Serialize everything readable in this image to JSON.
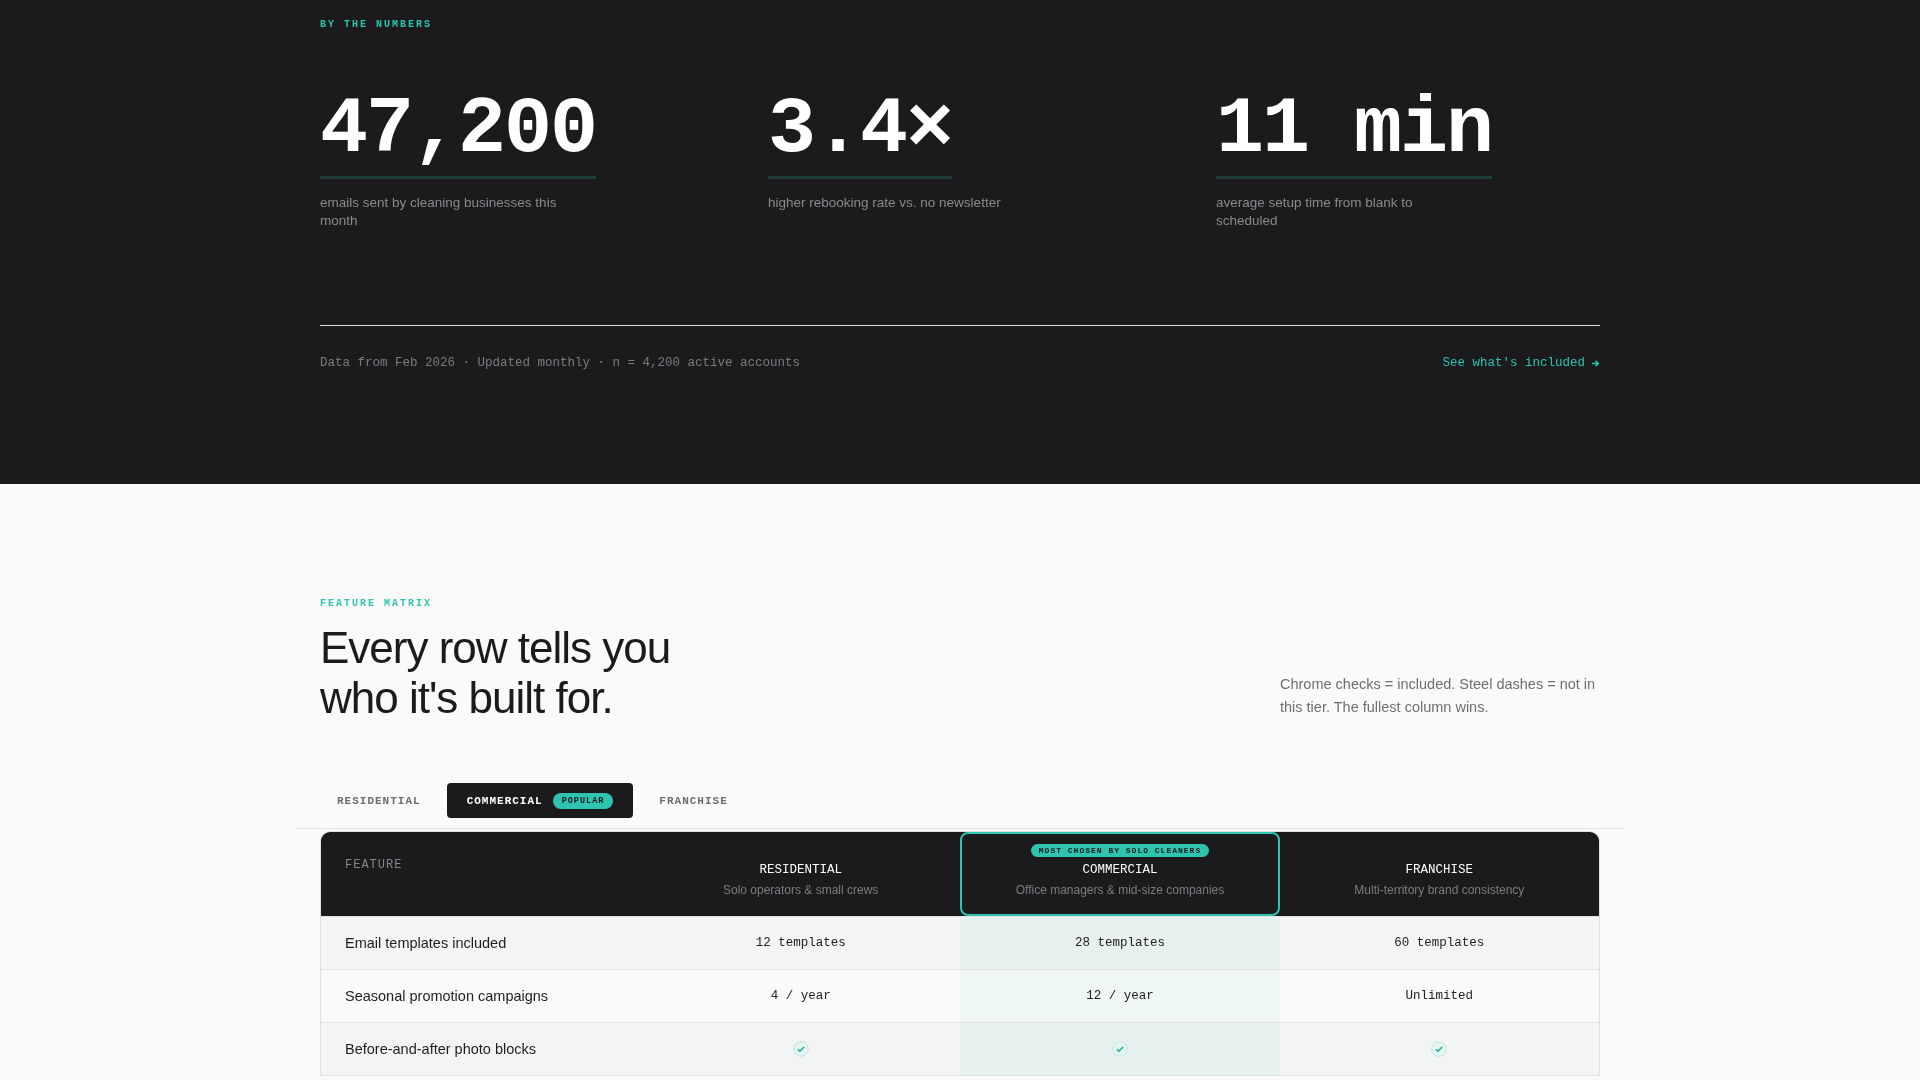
{
  "numbers": {
    "eyebrow": "BY THE NUMBERS",
    "stats": [
      {
        "value": "47,200",
        "caption": "emails sent by cleaning businesses this month"
      },
      {
        "value": "3.4×",
        "caption": "higher rebooking rate vs. no newsletter"
      },
      {
        "value": "11 min",
        "caption": "average setup time from blank to scheduled"
      }
    ],
    "footnote": "Data from Feb 2026 · Updated monthly · n = 4,200 active accounts",
    "link": "See what's included"
  },
  "matrix": {
    "eyebrow": "FEATURE MATRIX",
    "heading": "Every row tells you who it's built for.",
    "note": "Chrome checks = included. Steel dashes = not in this tier. The fullest column wins.",
    "tabs": [
      {
        "label": "RESIDENTIAL",
        "selected": false
      },
      {
        "label": "COMMERCIAL",
        "selected": true,
        "badge": "POPULAR"
      },
      {
        "label": "FRANCHISE",
        "selected": false
      }
    ],
    "feature_heading": "FEATURE",
    "columns": [
      {
        "name": "RESIDENTIAL",
        "subtitle": "Solo operators & small crews",
        "highlighted": false
      },
      {
        "name": "COMMERCIAL",
        "subtitle": "Office managers & mid-size companies",
        "highlighted": true,
        "badge": "MOST CHOSEN BY SOLO CLEANERS"
      },
      {
        "name": "FRANCHISE",
        "subtitle": "Multi-territory brand consistency",
        "highlighted": false
      }
    ],
    "rows": [
      {
        "feature": "Email templates included",
        "cells": [
          {
            "kind": "text",
            "text": "12 templates"
          },
          {
            "kind": "text",
            "text": "28 templates"
          },
          {
            "kind": "text",
            "text": "60 templates"
          }
        ]
      },
      {
        "feature": "Seasonal promotion campaigns",
        "cells": [
          {
            "kind": "text",
            "text": "4 / year"
          },
          {
            "kind": "text",
            "text": "12 / year"
          },
          {
            "kind": "text",
            "text": "Unlimited"
          }
        ]
      },
      {
        "feature": "Before-and-after photo blocks",
        "cells": [
          {
            "kind": "check"
          },
          {
            "kind": "check"
          },
          {
            "kind": "check"
          }
        ]
      }
    ]
  }
}
